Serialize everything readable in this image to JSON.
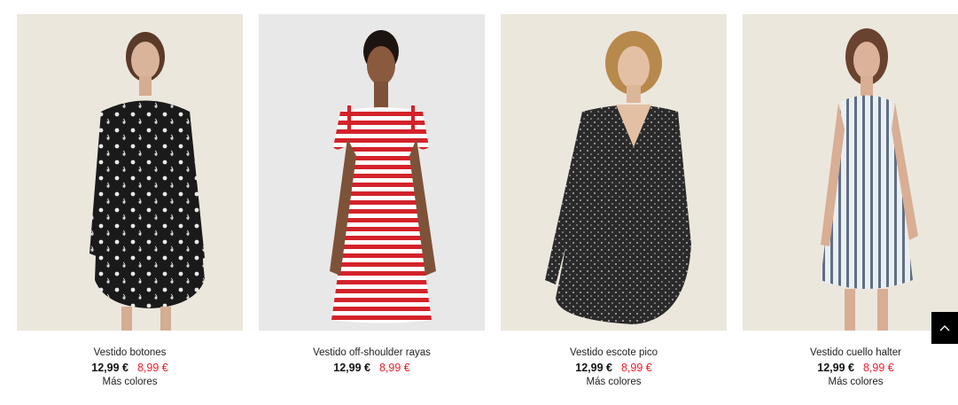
{
  "products": [
    {
      "name": "Vestido botones",
      "price_original": "12,99 €",
      "price_sale": "8,99 €",
      "more_colors": "Más colores",
      "background_color": "#ece7dd",
      "dress_pattern": "black-floral"
    },
    {
      "name": "Vestido off-shoulder rayas",
      "price_original": "12,99 €",
      "price_sale": "8,99 €",
      "more_colors": "",
      "background_color": "#e8e8e8",
      "dress_pattern": "red-white-stripes"
    },
    {
      "name": "Vestido escote pico",
      "price_original": "12,99 €",
      "price_sale": "8,99 €",
      "more_colors": "Más colores",
      "background_color": "#ece7dd",
      "dress_pattern": "black-dots"
    },
    {
      "name": "Vestido cuello halter",
      "price_original": "12,99 €",
      "price_sale": "8,99 €",
      "more_colors": "Más colores",
      "background_color": "#ece7dd",
      "dress_pattern": "blue-white-stripes"
    }
  ],
  "colors": {
    "sale_price": "#e8202e",
    "scroll_button": "#000000"
  },
  "scroll_top_icon": "chevron-up-icon"
}
